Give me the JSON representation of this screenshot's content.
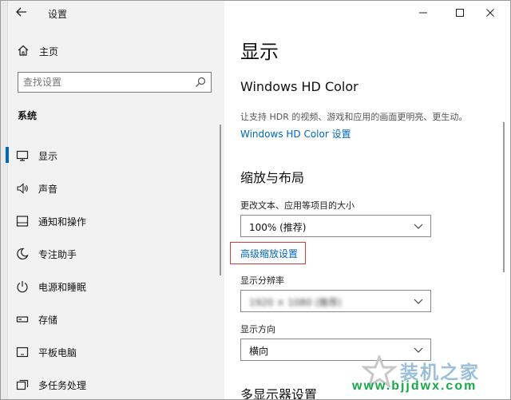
{
  "window": {
    "title": "设置"
  },
  "sidebar": {
    "home_label": "主页",
    "search_placeholder": "查找设置",
    "section_label": "系统",
    "items": [
      {
        "label": "显示",
        "icon": "monitor-icon",
        "active": true
      },
      {
        "label": "声音",
        "icon": "speaker-icon",
        "active": false
      },
      {
        "label": "通知和操作",
        "icon": "notification-icon",
        "active": false
      },
      {
        "label": "专注助手",
        "icon": "moon-icon",
        "active": false
      },
      {
        "label": "电源和睡眠",
        "icon": "power-icon",
        "active": false
      },
      {
        "label": "存储",
        "icon": "storage-icon",
        "active": false
      },
      {
        "label": "平板电脑",
        "icon": "tablet-icon",
        "active": false
      },
      {
        "label": "多任务处理",
        "icon": "multitask-icon",
        "active": false
      }
    ]
  },
  "main": {
    "page_title": "显示",
    "hd_color": {
      "heading": "Windows HD Color",
      "description": "让支持 HDR 的视频、游戏和应用的画面更明亮、更生动。",
      "link": "Windows HD Color 设置"
    },
    "scale_layout": {
      "heading": "缩放与布局",
      "size_label": "更改文本、应用等项目的大小",
      "size_value": "100% (推荐)",
      "advanced_link": "高级缩放设置",
      "resolution_label": "显示分辨率",
      "resolution_value": "1920 × 1080 (推荐)",
      "orientation_label": "显示方向",
      "orientation_value": "横向"
    },
    "multi_display_heading": "多显示器设置"
  },
  "watermark": {
    "brand": "装机之家",
    "url": "www.bjjdwx.com"
  },
  "colors": {
    "accent": "#0067c0",
    "sidebar_bg": "#f2f2f2",
    "highlight_box": "#c84040"
  }
}
